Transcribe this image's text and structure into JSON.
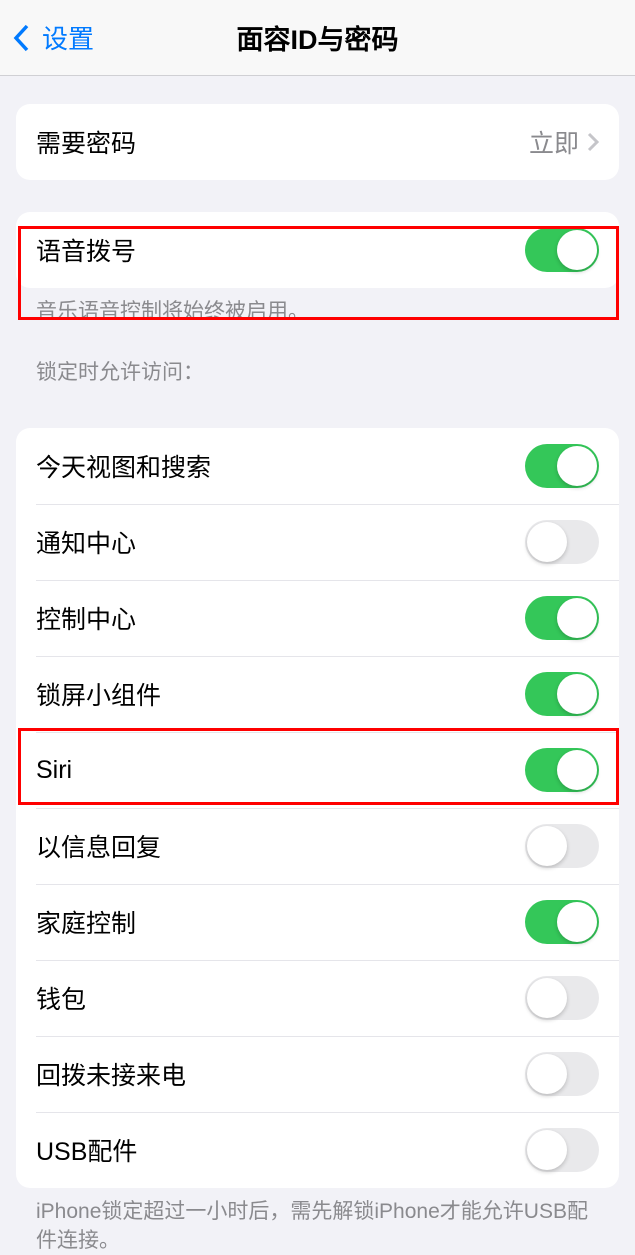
{
  "header": {
    "back_label": "设置",
    "title": "面容ID与密码"
  },
  "require_passcode": {
    "label": "需要密码",
    "value": "立即"
  },
  "voice_dial": {
    "label": "语音拨号",
    "on": true,
    "footer": "音乐语音控制将始终被启用。"
  },
  "lockscreen_section_header": "锁定时允许访问：",
  "lockscreen_items": [
    {
      "label": "今天视图和搜索",
      "on": true
    },
    {
      "label": "通知中心",
      "on": false
    },
    {
      "label": "控制中心",
      "on": true
    },
    {
      "label": "锁屏小组件",
      "on": true
    },
    {
      "label": "Siri",
      "on": true
    },
    {
      "label": "以信息回复",
      "on": false
    },
    {
      "label": "家庭控制",
      "on": true
    },
    {
      "label": "钱包",
      "on": false
    },
    {
      "label": "回拨未接来电",
      "on": false
    },
    {
      "label": "USB配件",
      "on": false
    }
  ],
  "usb_footer": "iPhone锁定超过一小时后，需先解锁iPhone才能允许USB配件连接。"
}
